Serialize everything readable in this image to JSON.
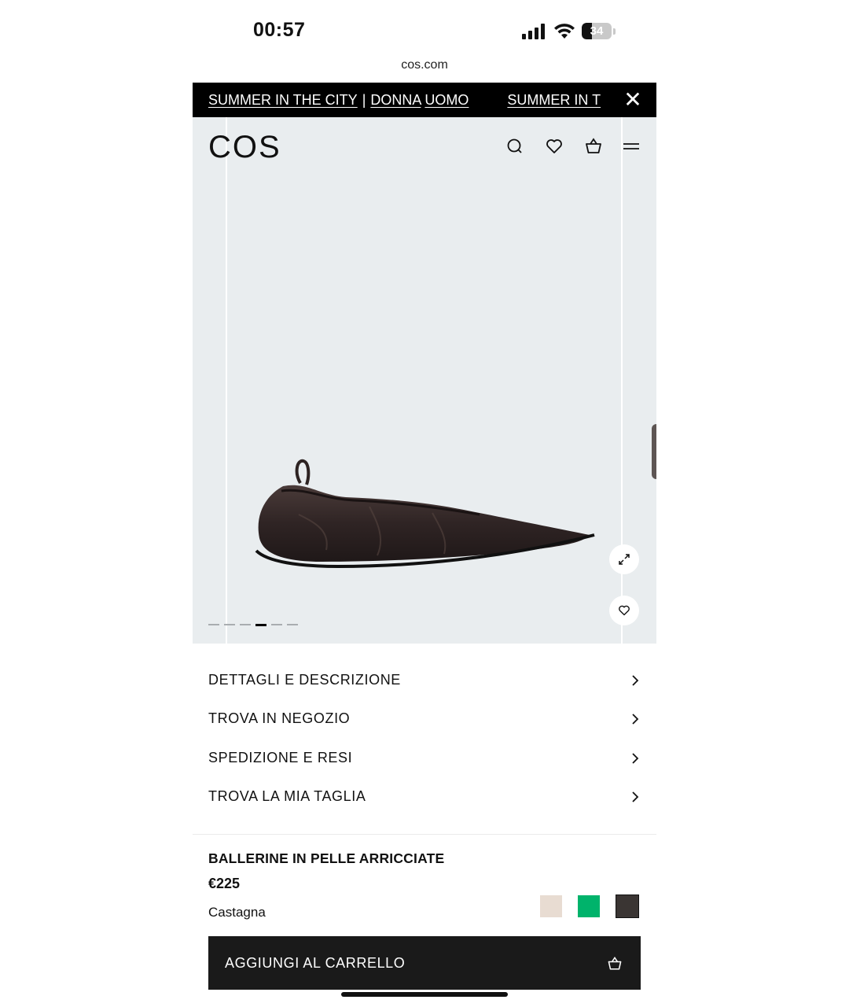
{
  "status_bar": {
    "time": "00:57",
    "battery": "34",
    "battery_level": 0.34
  },
  "browser": {
    "url": "cos.com"
  },
  "promo_bar": {
    "segments": [
      {
        "link": "SUMMER IN THE CITY",
        "sep": "|",
        "link2": "DONNA",
        "link3": "UOMO"
      },
      {
        "link": "SUMMER IN T"
      }
    ],
    "close_icon": "close-icon"
  },
  "header": {
    "logo": "COS",
    "icons": [
      "search-icon",
      "heart-icon",
      "bag-icon",
      "menu-icon"
    ]
  },
  "gallery": {
    "slide_count": 6,
    "active_slide": 4,
    "expand_icon": "expand-icon",
    "wishlist_icon": "heart-icon"
  },
  "accordion": [
    {
      "label": "DETTAGLI E DESCRIZIONE"
    },
    {
      "label": "TROVA IN NEGOZIO"
    },
    {
      "label": "SPEDIZIONE E RESI"
    },
    {
      "label": "TROVA LA MIA TAGLIA"
    }
  ],
  "product": {
    "name": "BALLERINE IN PELLE ARRICCIATE",
    "price": "€225",
    "color": "Castagna",
    "swatches": [
      {
        "color": "#e8dcd2",
        "selected": false
      },
      {
        "color": "#00b36b",
        "selected": false
      },
      {
        "color": "#3a3533",
        "selected": true
      }
    ]
  },
  "cart_button": {
    "label": "AGGIUNGI AL CARRELLO",
    "icon": "bag-icon"
  }
}
